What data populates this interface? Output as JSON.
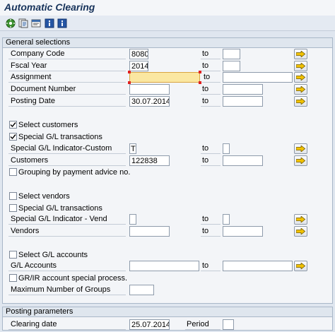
{
  "title": "Automatic Clearing",
  "toolbar": {
    "icons": [
      "execute-icon",
      "save-variant-icon",
      "get-variant-icon",
      "info-icon",
      "info-icon"
    ]
  },
  "general": {
    "header": "General selections",
    "to_label": "to",
    "company_code": {
      "label": "Company Code",
      "value": "8080",
      "to_value": ""
    },
    "fiscal_year": {
      "label": "Fscal Year",
      "value": "2014",
      "to_value": ""
    },
    "assignment": {
      "label": "Assignment",
      "value": "",
      "to_value": ""
    },
    "document_number": {
      "label": "Document Number",
      "value": "",
      "to_value": ""
    },
    "posting_date": {
      "label": "Posting Date",
      "value": "30.07.2014",
      "to_value": ""
    },
    "select_customers": {
      "label": "Select customers",
      "checked": true
    },
    "special_gl_customers": {
      "label": "Special G/L transactions",
      "checked": true
    },
    "sgl_indicator_custom": {
      "label": "Special G/L Indicator-Custom",
      "value": "T",
      "to_value": ""
    },
    "customers": {
      "label": "Customers",
      "value": "122838",
      "to_value": ""
    },
    "grouping_payment_advice": {
      "label": "Grouping by payment advice no.",
      "checked": false
    },
    "select_vendors": {
      "label": "Select vendors",
      "checked": false
    },
    "special_gl_vendors": {
      "label": "Special G/L transactions",
      "checked": false
    },
    "sgl_indicator_vend": {
      "label": "Special G/L Indicator - Vend",
      "value": "",
      "to_value": ""
    },
    "vendors": {
      "label": "Vendors",
      "value": "",
      "to_value": ""
    },
    "select_gl_accounts": {
      "label": "Select G/L accounts",
      "checked": false
    },
    "gl_accounts": {
      "label": "G/L Accounts",
      "value": "",
      "to_value": ""
    },
    "grir_special": {
      "label": "GR/IR account special process.",
      "checked": false
    },
    "max_groups": {
      "label": "Maximum Number of Groups",
      "value": ""
    }
  },
  "posting": {
    "header": "Posting parameters",
    "clearing_date": {
      "label": "Clearing date",
      "value": "25.07.2014"
    },
    "period": {
      "label": "Period",
      "value": ""
    }
  },
  "colors": {
    "title": "#16325a",
    "active_field": "#fbe7a1",
    "arrow": "#f2c200"
  }
}
